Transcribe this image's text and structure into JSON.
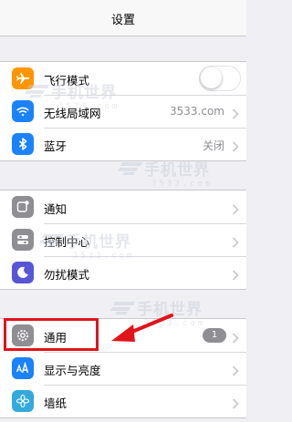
{
  "navbar": {
    "title": "设置"
  },
  "group1": {
    "airplane": {
      "label": "飞行模式",
      "toggle_on": false
    },
    "wifi": {
      "label": "无线局域网",
      "value": "3533.com"
    },
    "bluetooth": {
      "label": "蓝牙",
      "value": "关闭"
    }
  },
  "group2": {
    "notifications": {
      "label": "通知"
    },
    "control_center": {
      "label": "控制中心"
    },
    "dnd": {
      "label": "勿扰模式"
    }
  },
  "group3": {
    "general": {
      "label": "通用",
      "badge": "1"
    },
    "display": {
      "label": "显示与亮度"
    },
    "wallpaper": {
      "label": "墙纸"
    }
  },
  "watermark": {
    "text": "手机世界",
    "sub": "3533.com"
  },
  "colors": {
    "airplane": "#ff9500",
    "wifi": "#1a82fb",
    "bluetooth": "#1a82fb",
    "notifications": "#8e8e93",
    "control_center": "#8e8e93",
    "dnd": "#5856d6",
    "general": "#8e8e93",
    "display": "#1a82fb",
    "wallpaper": "#34aadc",
    "highlight": "#e1141b"
  },
  "icons": {
    "airplane": "airplane-icon",
    "wifi": "wifi-icon",
    "bluetooth": "bluetooth-icon",
    "notifications": "notifications-icon",
    "control_center": "control-center-icon",
    "dnd": "moon-icon",
    "general": "gear-icon",
    "display": "text-size-icon",
    "wallpaper": "flower-icon"
  }
}
